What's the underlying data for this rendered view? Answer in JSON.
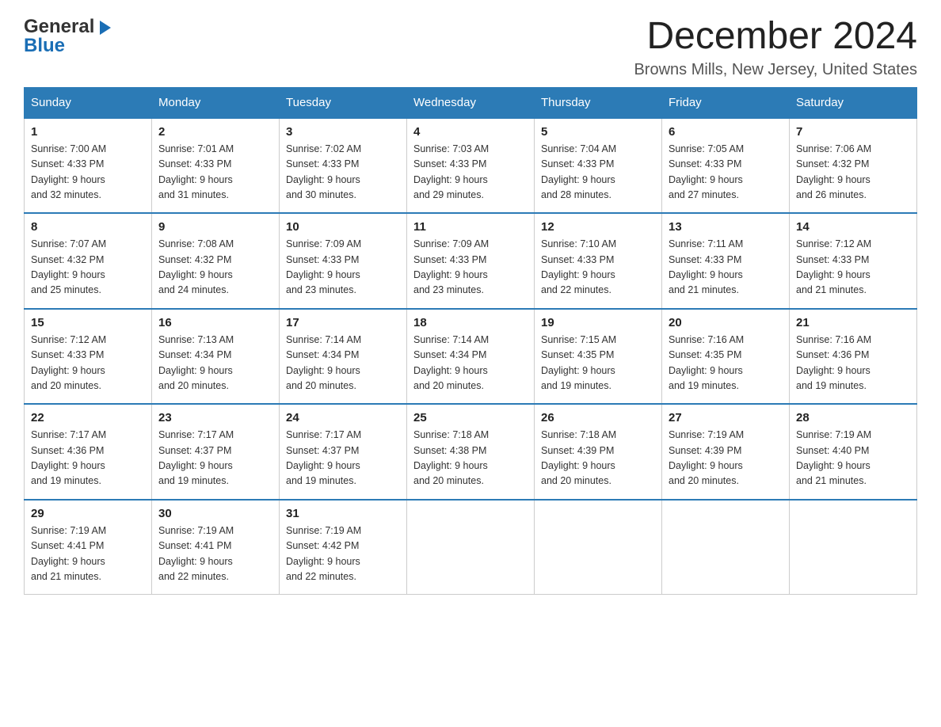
{
  "header": {
    "logo_general": "General",
    "logo_blue": "Blue",
    "month_title": "December 2024",
    "location": "Browns Mills, New Jersey, United States"
  },
  "weekdays": [
    "Sunday",
    "Monday",
    "Tuesday",
    "Wednesday",
    "Thursday",
    "Friday",
    "Saturday"
  ],
  "weeks": [
    [
      {
        "day": "1",
        "sunrise": "7:00 AM",
        "sunset": "4:33 PM",
        "daylight": "9 hours and 32 minutes."
      },
      {
        "day": "2",
        "sunrise": "7:01 AM",
        "sunset": "4:33 PM",
        "daylight": "9 hours and 31 minutes."
      },
      {
        "day": "3",
        "sunrise": "7:02 AM",
        "sunset": "4:33 PM",
        "daylight": "9 hours and 30 minutes."
      },
      {
        "day": "4",
        "sunrise": "7:03 AM",
        "sunset": "4:33 PM",
        "daylight": "9 hours and 29 minutes."
      },
      {
        "day": "5",
        "sunrise": "7:04 AM",
        "sunset": "4:33 PM",
        "daylight": "9 hours and 28 minutes."
      },
      {
        "day": "6",
        "sunrise": "7:05 AM",
        "sunset": "4:33 PM",
        "daylight": "9 hours and 27 minutes."
      },
      {
        "day": "7",
        "sunrise": "7:06 AM",
        "sunset": "4:32 PM",
        "daylight": "9 hours and 26 minutes."
      }
    ],
    [
      {
        "day": "8",
        "sunrise": "7:07 AM",
        "sunset": "4:32 PM",
        "daylight": "9 hours and 25 minutes."
      },
      {
        "day": "9",
        "sunrise": "7:08 AM",
        "sunset": "4:32 PM",
        "daylight": "9 hours and 24 minutes."
      },
      {
        "day": "10",
        "sunrise": "7:09 AM",
        "sunset": "4:33 PM",
        "daylight": "9 hours and 23 minutes."
      },
      {
        "day": "11",
        "sunrise": "7:09 AM",
        "sunset": "4:33 PM",
        "daylight": "9 hours and 23 minutes."
      },
      {
        "day": "12",
        "sunrise": "7:10 AM",
        "sunset": "4:33 PM",
        "daylight": "9 hours and 22 minutes."
      },
      {
        "day": "13",
        "sunrise": "7:11 AM",
        "sunset": "4:33 PM",
        "daylight": "9 hours and 21 minutes."
      },
      {
        "day": "14",
        "sunrise": "7:12 AM",
        "sunset": "4:33 PM",
        "daylight": "9 hours and 21 minutes."
      }
    ],
    [
      {
        "day": "15",
        "sunrise": "7:12 AM",
        "sunset": "4:33 PM",
        "daylight": "9 hours and 20 minutes."
      },
      {
        "day": "16",
        "sunrise": "7:13 AM",
        "sunset": "4:34 PM",
        "daylight": "9 hours and 20 minutes."
      },
      {
        "day": "17",
        "sunrise": "7:14 AM",
        "sunset": "4:34 PM",
        "daylight": "9 hours and 20 minutes."
      },
      {
        "day": "18",
        "sunrise": "7:14 AM",
        "sunset": "4:34 PM",
        "daylight": "9 hours and 20 minutes."
      },
      {
        "day": "19",
        "sunrise": "7:15 AM",
        "sunset": "4:35 PM",
        "daylight": "9 hours and 19 minutes."
      },
      {
        "day": "20",
        "sunrise": "7:16 AM",
        "sunset": "4:35 PM",
        "daylight": "9 hours and 19 minutes."
      },
      {
        "day": "21",
        "sunrise": "7:16 AM",
        "sunset": "4:36 PM",
        "daylight": "9 hours and 19 minutes."
      }
    ],
    [
      {
        "day": "22",
        "sunrise": "7:17 AM",
        "sunset": "4:36 PM",
        "daylight": "9 hours and 19 minutes."
      },
      {
        "day": "23",
        "sunrise": "7:17 AM",
        "sunset": "4:37 PM",
        "daylight": "9 hours and 19 minutes."
      },
      {
        "day": "24",
        "sunrise": "7:17 AM",
        "sunset": "4:37 PM",
        "daylight": "9 hours and 19 minutes."
      },
      {
        "day": "25",
        "sunrise": "7:18 AM",
        "sunset": "4:38 PM",
        "daylight": "9 hours and 20 minutes."
      },
      {
        "day": "26",
        "sunrise": "7:18 AM",
        "sunset": "4:39 PM",
        "daylight": "9 hours and 20 minutes."
      },
      {
        "day": "27",
        "sunrise": "7:19 AM",
        "sunset": "4:39 PM",
        "daylight": "9 hours and 20 minutes."
      },
      {
        "day": "28",
        "sunrise": "7:19 AM",
        "sunset": "4:40 PM",
        "daylight": "9 hours and 21 minutes."
      }
    ],
    [
      {
        "day": "29",
        "sunrise": "7:19 AM",
        "sunset": "4:41 PM",
        "daylight": "9 hours and 21 minutes."
      },
      {
        "day": "30",
        "sunrise": "7:19 AM",
        "sunset": "4:41 PM",
        "daylight": "9 hours and 22 minutes."
      },
      {
        "day": "31",
        "sunrise": "7:19 AM",
        "sunset": "4:42 PM",
        "daylight": "9 hours and 22 minutes."
      },
      null,
      null,
      null,
      null
    ]
  ],
  "labels": {
    "sunrise": "Sunrise:",
    "sunset": "Sunset:",
    "daylight": "Daylight:"
  }
}
